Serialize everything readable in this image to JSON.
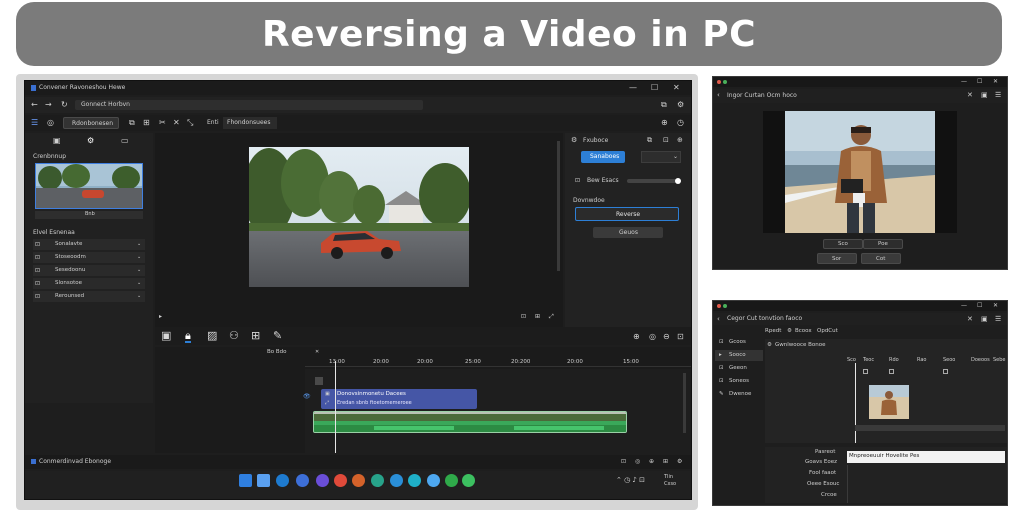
{
  "banner": {
    "title": "Reversing a Video in  PC"
  },
  "main": {
    "window_title": "Convener Ravoneshou Hewe",
    "address": "Gonnect Horbvn",
    "toolbar": {
      "project_button": "Rdonbonesen",
      "mode": "Enti",
      "mode_value": "Fhondonsuees"
    },
    "media": {
      "section": "Crenbnnup",
      "thumb_label": "Bnb",
      "effects_title": "Elvel Esnenaa",
      "effects": [
        "Sonalavte",
        "Stoseoodm",
        "Sesedoonu",
        "Slonsotoe",
        "Rerounsed"
      ]
    },
    "props": {
      "title": "Fxuboce",
      "primary_button": "Sanaboes",
      "select_value": "",
      "speed_label": "Bew Esacs",
      "section": "Dovnwdoe",
      "reverse_button": "Reverse",
      "ok_button": "Geuos"
    },
    "timeline": {
      "playback": "Bo Bdo",
      "ruler": [
        "13:00",
        "20:00",
        "20:00",
        "25:00",
        "20:200",
        "20:00",
        "15:00"
      ],
      "clip_label": "Donovsinmonetu Dacees",
      "clip_sub": "Eredan sbnb ftoetomemeroee"
    },
    "status": {
      "text": "Conmerdinvad Ebonoge"
    },
    "tray": {
      "time": "Tlin",
      "date": "Cxso"
    }
  },
  "right_top": {
    "title": "Ingor Curtan Ocm hoco",
    "btn_a": "Sco",
    "btn_b": "Poe",
    "btn_c": "Sor",
    "btn_d": "Cot"
  },
  "right_bottom": {
    "title": "Cegor Cut tonvtion faoco",
    "menu": [
      "Rpedt",
      "Bcoox",
      "OpdCut"
    ],
    "sidebar": [
      "Gcoos",
      "Sooco",
      "Geeon",
      "Soneos",
      "Dwenoe"
    ],
    "panel_title": "Gwnlwooce Bonoe",
    "ruler": [
      "Sco",
      "Teoc",
      "Rdo",
      "Rao",
      "Seoo",
      "Doeoos",
      "Sebe"
    ],
    "labels": [
      "Pasreot",
      "Goavs Eoez",
      "Fool faaot",
      "Oeee Esouc",
      "Crcoe"
    ],
    "text_field": "Mnpreoeuuir Hovelite Pes"
  },
  "colors": {
    "accent": "#2d7fd6",
    "clip_blue": "#4556a6",
    "clip_green": "#2f9a4a"
  }
}
